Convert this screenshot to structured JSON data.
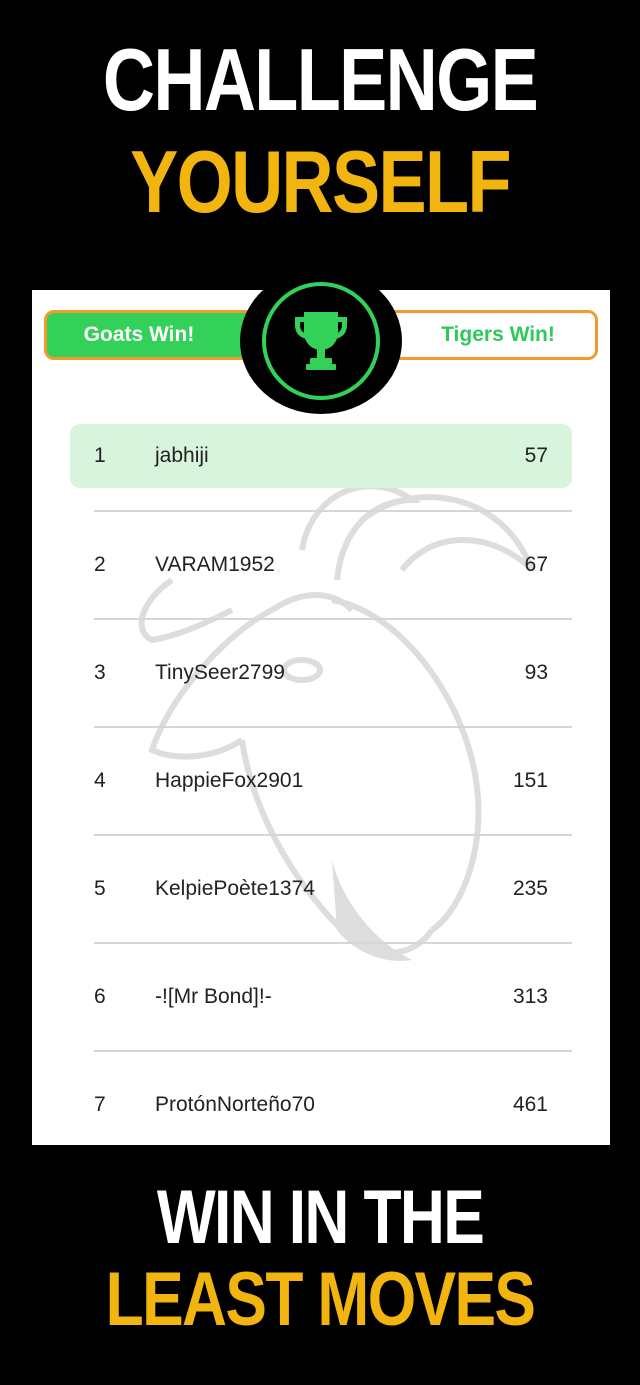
{
  "headline": {
    "line1": "CHALLENGE",
    "line2": "YOURSELF",
    "line3": "WIN IN THE",
    "line4": "LEAST MOVES"
  },
  "tabs": {
    "goats_label": "Goats Win!",
    "tigers_label": "Tigers Win!"
  },
  "badge": {
    "icon": "trophy-icon"
  },
  "leaderboard": [
    {
      "rank": "1",
      "name": "jabhiji",
      "score": "57"
    },
    {
      "rank": "2",
      "name": "VARAM1952",
      "score": "67"
    },
    {
      "rank": "3",
      "name": "TinySeer2799",
      "score": "93"
    },
    {
      "rank": "4",
      "name": "HappieFox2901",
      "score": "151"
    },
    {
      "rank": "5",
      "name": "KelpiePoète1374",
      "score": "235"
    },
    {
      "rank": "6",
      "name": "-![Mr Bond]!-",
      "score": "313"
    },
    {
      "rank": "7",
      "name": "ProtónNorteño70",
      "score": "461"
    }
  ],
  "colors": {
    "accent_green": "#34d15a",
    "accent_yellow": "#f2b40f",
    "tab_border_orange": "#f39a2e",
    "highlight_row": "#d9f4dd"
  }
}
